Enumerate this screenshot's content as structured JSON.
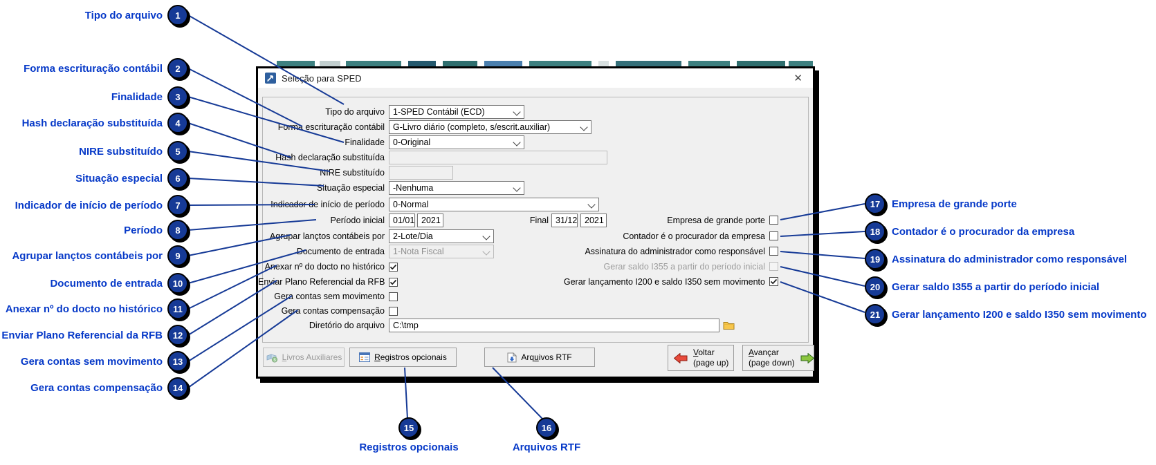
{
  "window": {
    "title": "Seleção para SPED",
    "close_icon": "✕"
  },
  "fields": {
    "tipo_arquivo": {
      "label": "Tipo do arquivo",
      "value": "1-SPED Contábil (ECD)"
    },
    "forma_escrituracao": {
      "label": "Forma escrituração contábil",
      "value": "G-Livro diário (completo, s/escrit.auxiliar)"
    },
    "finalidade": {
      "label": "Finalidade",
      "value": "0-Original"
    },
    "hash_declaracao": {
      "label": "Hash declaração substituída",
      "value": ""
    },
    "nire": {
      "label": "NIRE substituído",
      "value": ""
    },
    "situacao_especial": {
      "label": "Situação especial",
      "value": "-Nenhuma"
    },
    "indicador_inicio": {
      "label": "Indicador de início de período",
      "value": "0-Normal"
    },
    "periodo": {
      "label": "Período inicial",
      "inicio_data": "01/01",
      "inicio_ano": "2021",
      "final_label": "Final",
      "final_data": "31/12",
      "final_ano": "2021"
    },
    "agrupar": {
      "label": "Agrupar lançtos contábeis por",
      "value": "2-Lote/Dia"
    },
    "documento_entrada": {
      "label": "Documento de entrada",
      "value": "1-Nota Fiscal",
      "disabled": true
    },
    "anexar_docto": {
      "label": "Anexar nº do docto no histórico",
      "checked": true
    },
    "enviar_plano": {
      "label": "Enviar Plano Referencial da RFB",
      "checked": true
    },
    "gera_sem_movimento": {
      "label": "Gera contas sem movimento",
      "checked": false
    },
    "gera_compensacao": {
      "label": "Gera contas compensação",
      "checked": false
    },
    "diretorio": {
      "label": "Diretório do arquivo",
      "value": "C:\\tmp"
    }
  },
  "right_options": [
    {
      "label": "Empresa de grande porte",
      "checked": false
    },
    {
      "label": "Contador é o procurador da empresa",
      "checked": false
    },
    {
      "label": "Assinatura do administrador como responsável",
      "checked": false
    },
    {
      "label": "Gerar saldo I355 a partir do período inicial",
      "checked": false,
      "disabled": true
    },
    {
      "label": "Gerar lançamento I200 e saldo I350 sem movimento",
      "checked": true
    }
  ],
  "buttons": {
    "livros": {
      "u": "L",
      "post": "ivros Auxiliares"
    },
    "registros": {
      "u": "R",
      "post": "egistros opcionais"
    },
    "arquivos": {
      "pre": "Arq",
      "u": "u",
      "post": "ivos RTF"
    },
    "voltar": {
      "u": "V",
      "post": "oltar",
      "line2": "(page up)"
    },
    "avancar": {
      "u": "A",
      "post": "vançar",
      "line2": "(page down)"
    }
  },
  "callouts": [
    {
      "num": "1",
      "label": "Tipo do arquivo"
    },
    {
      "num": "2",
      "label": "Forma escrituração contábil"
    },
    {
      "num": "3",
      "label": "Finalidade"
    },
    {
      "num": "4",
      "label": "Hash declaração substituída"
    },
    {
      "num": "5",
      "label": "NIRE substituído"
    },
    {
      "num": "6",
      "label": "Situação especial"
    },
    {
      "num": "7",
      "label": "Indicador de início de período"
    },
    {
      "num": "8",
      "label": "Período"
    },
    {
      "num": "9",
      "label": "Agrupar lançtos contábeis por"
    },
    {
      "num": "10",
      "label": "Documento de entrada"
    },
    {
      "num": "11",
      "label": "Anexar nº do docto no histórico"
    },
    {
      "num": "12",
      "label": "Enviar Plano Referencial da RFB"
    },
    {
      "num": "13",
      "label": "Gera contas sem movimento"
    },
    {
      "num": "14",
      "label": "Gera contas compensação"
    },
    {
      "num": "15",
      "label": "Registros opcionais"
    },
    {
      "num": "16",
      "label": "Arquivos RTF"
    },
    {
      "num": "17",
      "label": "Empresa de grande porte"
    },
    {
      "num": "18",
      "label": "Contador é o procurador da empresa"
    },
    {
      "num": "19",
      "label": "Assinatura do administrador como responsável"
    },
    {
      "num": "20",
      "label": "Gerar saldo I355 a partir do período inicial"
    },
    {
      "num": "21",
      "label": "Gerar lançamento I200 e saldo I350 sem movimento"
    }
  ],
  "colors": {
    "accent_navy": "#163a96",
    "callout_blue": "#0639c8",
    "dialog_bg": "#f0f0f0"
  }
}
